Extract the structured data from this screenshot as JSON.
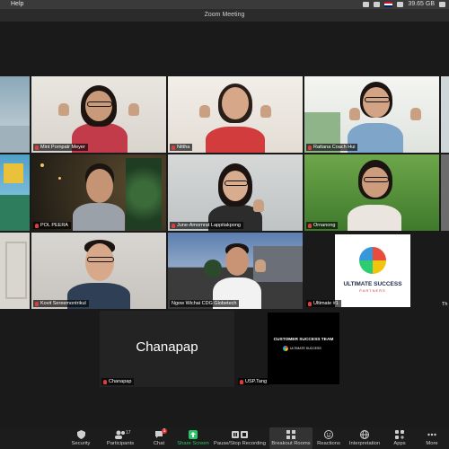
{
  "menubar": {
    "help": "Help",
    "storage": "39.65 GB"
  },
  "window": {
    "title": "Zoom Meeting"
  },
  "participants": [
    {
      "name": "Mint Pornpatr Meyer"
    },
    {
      "name": "Nittha"
    },
    {
      "name": "Rattana Coach Hui"
    },
    {
      "name": "POL PEERA"
    },
    {
      "name": "June-Amornrat Lappitakpong"
    },
    {
      "name": "Ornanong"
    },
    {
      "name": "Kovit Sereemontrikul"
    },
    {
      "name": "Ngow Wichai CDG Globetech"
    },
    {
      "name": "Ultimate #1"
    },
    {
      "name": "Chanapap"
    },
    {
      "name": "USP.Tang"
    }
  ],
  "tiles": {
    "chanapap_big": "Chanapap",
    "usp_logo_title": "CUSTOMER SUCCESS TEAM",
    "ultimate_logo_line1": "ULTIMATE SUCCESS",
    "ultimate_logo_line2": "PARTNERS",
    "usp_small_logo": "ULTIMATE SUCCESS",
    "edge_right_partial": "Th"
  },
  "toolbar": {
    "security": "Security",
    "participants": "Participants",
    "participants_count": "17",
    "chat": "Chat",
    "chat_badge": "1",
    "share": "Share Screen",
    "record": "Pause/Stop Recording",
    "breakout": "Breakout Rooms",
    "reactions": "Reactions",
    "interpretation": "Interpretation",
    "apps": "Apps",
    "more": "More"
  },
  "colors": {
    "share_green": "#2bc46b",
    "mic_red": "#e23b3b",
    "active_speaker_border": "#c8d86a"
  }
}
